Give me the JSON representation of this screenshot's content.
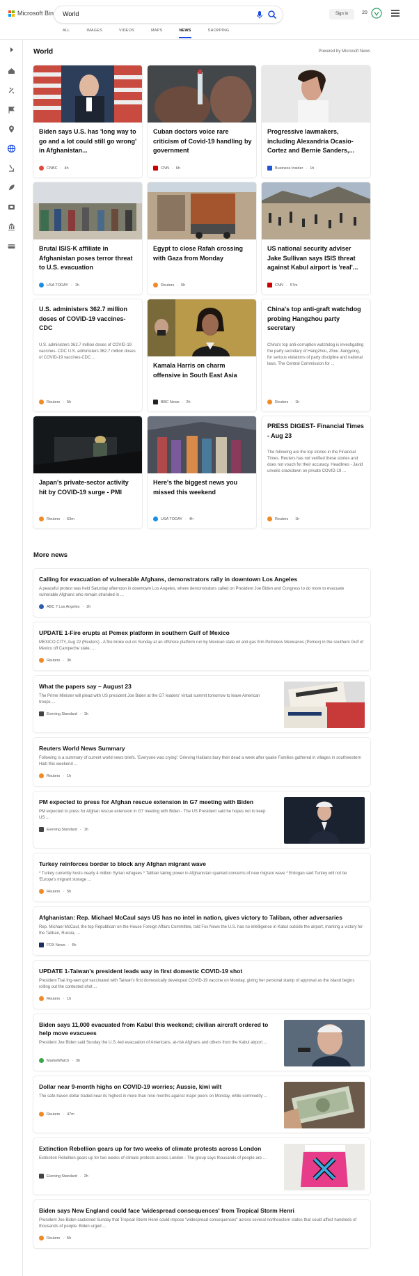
{
  "brand": {
    "name": "Microsoft Bing"
  },
  "search": {
    "query": "World"
  },
  "header": {
    "signin": "Sign in",
    "points": "20"
  },
  "scopes": [
    "ALL",
    "IMAGES",
    "VIDEOS",
    "MAPS",
    "NEWS",
    "SHOPPING"
  ],
  "active_scope": "NEWS",
  "sidebar": {
    "icons": [
      "chevron-right-icon",
      "home-icon",
      "tools-icon",
      "flag-icon",
      "location-icon",
      "globe-icon",
      "microscope-icon",
      "rocket-icon",
      "film-icon",
      "building-icon",
      "money-icon"
    ]
  },
  "section": {
    "title": "World",
    "powered": "Powered by Microsoft News"
  },
  "cards": [
    {
      "title": "Biden says U.S. has 'long way to go and a lot could still go wrong' in Afghanistan...",
      "snippet": "",
      "source": "CNBC",
      "time": "4h",
      "color": "#e04a3b"
    },
    {
      "title": "Cuban doctors voice rare criticism of Covid-19 handling by government",
      "snippet": "",
      "source": "CNN",
      "time": "6h",
      "color": "#cc0000"
    },
    {
      "title": "Progressive lawmakers, including Alexandria Ocasio-Cortez and Bernie Sanders,...",
      "snippet": "",
      "source": "Business Insider",
      "time": "1h",
      "color": "#1f55d6"
    },
    {
      "title": "Brutal ISIS-K affiliate in Afghanistan poses terror threat to U.S. evacuation",
      "snippet": "",
      "source": "USA TODAY",
      "time": "1h",
      "color": "#1a8ee0"
    },
    {
      "title": "Egypt to close Rafah crossing with Gaza from Monday",
      "snippet": "",
      "source": "Reuters",
      "time": "5h",
      "color": "#f08a24"
    },
    {
      "title": "US national security adviser Jake Sullivan says ISIS threat against Kabul airport is 'real'...",
      "snippet": "",
      "source": "CNN",
      "time": "57m",
      "color": "#cc0000"
    },
    {
      "title": "U.S. administers 362.7 million doses of COVID-19 vaccines-CDC",
      "snippet": "U.S. administers 362.7 million doses of COVID-19 vaccines- CDC U.S. administers 362.7 million doses of COVID-19 vaccines-CDC ...",
      "source": "Reuters",
      "time": "5h",
      "color": "#f08a24"
    },
    {
      "title": "Kamala Harris on charm offensive in South East Asia",
      "snippet": "",
      "source": "BBC News",
      "time": "2h",
      "color": "#222222"
    },
    {
      "title": "China's top anti-graft watchdog probing Hangzhou party secretary",
      "snippet": "China's top anti-corruption watchdog is investigating the party secretary of Hangzhou, Zhou Jiangyong, for serious violations of party discipline and national laws. The Central Commission for ...",
      "source": "Reuters",
      "time": "1h",
      "color": "#f08a24"
    },
    {
      "title": "Japan's private-sector activity hit by COVID-19 surge - PMI",
      "snippet": "",
      "source": "Reuters",
      "time": "53m",
      "color": "#f08a24"
    },
    {
      "title": "Here's the biggest news you missed this weekend",
      "snippet": "",
      "source": "USA TODAY",
      "time": "4h",
      "color": "#1a8ee0"
    },
    {
      "title": "PRESS DIGEST- Financial Times - Aug 23",
      "snippet": "The following are the top stories in the Financial Times. Reuters has not verified these stories and does not vouch for their accuracy. Headlines - Javid unveils crackdown on private COVID-19 ...",
      "source": "Reuters",
      "time": "1h",
      "color": "#f08a24"
    }
  ],
  "more_news_title": "More news",
  "more_news": [
    {
      "title": "Calling for evacuation of vulnerable Afghans, demonstrators rally in downtown Los Angeles",
      "snippet": "A peaceful protest was held Saturday afternoon in downtown Los Angeles, where demonstrators called on President Joe Biden and Congress to do more to evacuate vulnerable Afghans who remain stranded in ...",
      "source": "ABC 7 Los Angeles",
      "time": "2h",
      "color": "#2a5db0"
    },
    {
      "title": "UPDATE 1-Fire erupts at Pemex platform in southern Gulf of Mexico",
      "snippet": "MEXICO CITY, Aug 22 (Reuters) - A fire broke out on Sunday at an offshore platform run by Mexican state oil and gas firm Petroleos Mexicanos (Pemex) in the southern Gulf of Mexico off Campeche state, ...",
      "source": "Reuters",
      "time": "3h",
      "color": "#f08a24"
    },
    {
      "title": "What the papers say – August 23",
      "snippet": "The Prime Minister will plead with US president Joe Biden at the G7 leaders' virtual summit tomorrow to leave American troops ...",
      "source": "Evening Standard",
      "time": "1h",
      "color": "#444444"
    },
    {
      "title": "Reuters World News Summary",
      "snippet": "Following is a summary of current world news briefs. 'Everyone was crying': Grieving Haitians bury their dead a week after quake Families gathered in villages in southwestern Haiti this weekend ...",
      "source": "Reuters",
      "time": "1h",
      "color": "#f08a24"
    },
    {
      "title": "PM expected to press for Afghan rescue extension in G7 meeting with Biden",
      "snippet": "PM expected to press for Afghan rescue extension in G7 meeting with Biden - The US President said he hopes not to keep US ...",
      "source": "Evening Standard",
      "time": "1h",
      "color": "#444444"
    },
    {
      "title": "Turkey reinforces border to block any Afghan migrant wave",
      "snippet": "* Turkey currently hosts nearly 4 million Syrian refugees * Taliban taking power in Afghanistan sparked concerns of new migrant wave * Erdogan said Turkey will not be 'Europe's migrant storage ...",
      "source": "Reuters",
      "time": "5h",
      "color": "#f08a24"
    },
    {
      "title": "Afghanistan: Rep. Michael McCaul says US has no intel in nation, gives victory to Taliban, other adversaries",
      "snippet": "Rep. Michael McCaul, the top Republican on the House Foreign Affairs Committee, told Fox News the U.S. has no intelligence in Kabul outside the airport, marking a victory for the Taliban, Russia, ...",
      "source": "FOX News",
      "time": "6h",
      "color": "#1b2e5e"
    },
    {
      "title": "UPDATE 1-Taiwan's president leads way in first domestic COVID-19 shot",
      "snippet": "President Tsai Ing-wen got vaccinated with Taiwan's first domestically developed COVID-19 vaccine on Monday, giving her personal stamp of approval as the island begins rolling out the contested shot ...",
      "source": "Reuters",
      "time": "1h",
      "color": "#f08a24"
    },
    {
      "title": "Biden says 11,000 evacuated from Kabul this weekend; civilian aircraft ordered to help move evacuees",
      "snippet": "President Joe Biden said Sunday the U.S.-led evacuation of Americans, at-risk Afghans and others from the Kabul airport ...",
      "source": "MarketWatch",
      "time": "3h",
      "color": "#3aa64a"
    },
    {
      "title": "Dollar near 9-month highs on COVID-19 worries; Aussie, kiwi wilt",
      "snippet": "The safe-haven dollar traded near its highest in more than nine months against major peers on Monday, while commodity ...",
      "source": "Reuters",
      "time": "47m",
      "color": "#f08a24"
    },
    {
      "title": "Extinction Rebellion gears up for two weeks of climate protests across London",
      "snippet": "Extinction Rebellion gears up for two weeks of climate protests across London - The group says thousands of people are ...",
      "source": "Evening Standard",
      "time": "2h",
      "color": "#444444"
    },
    {
      "title": "Biden says New England could face 'widespread consequences' from Tropical Storm Henri",
      "snippet": "President Joe Biden cautioned Sunday that Tropical Storm Henri could impose \"widespread consequences\" across several northeastern states that could affect hundreds of thousands of people. Biden urged ...",
      "source": "Reuters",
      "time": "5h",
      "color": "#f08a24"
    }
  ]
}
